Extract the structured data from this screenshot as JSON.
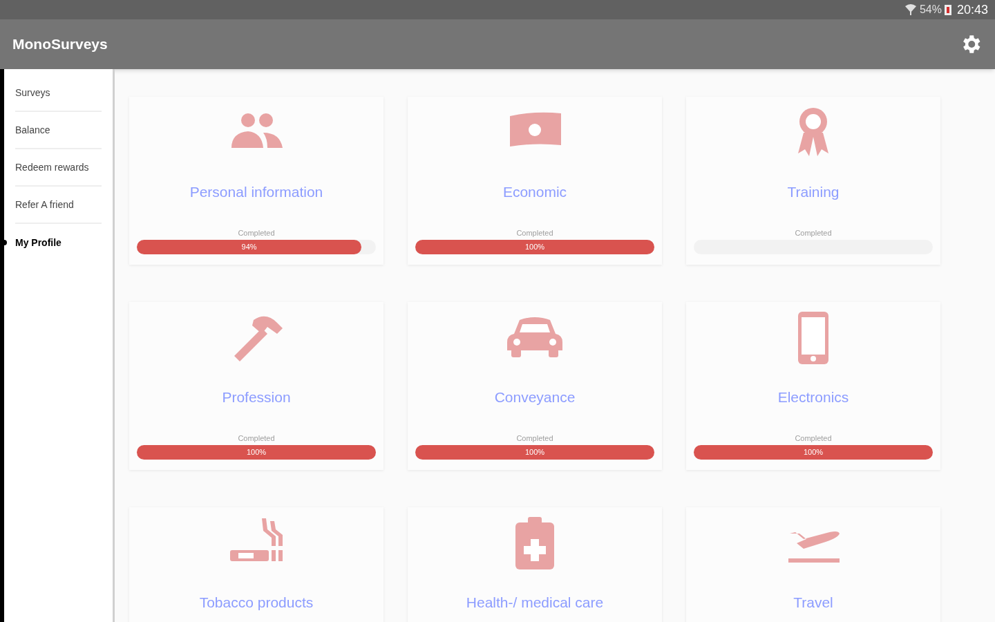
{
  "status_bar": {
    "battery": "54%",
    "time": "20:43"
  },
  "app_bar": {
    "title": "MonoSurveys"
  },
  "sidebar": {
    "items": [
      {
        "label": "Surveys",
        "selected": false
      },
      {
        "label": "Balance",
        "selected": false
      },
      {
        "label": "Redeem rewards",
        "selected": false
      },
      {
        "label": "Refer A friend",
        "selected": false
      },
      {
        "label": "My Profile",
        "selected": true
      }
    ]
  },
  "surveys": [
    {
      "title": "Personal information",
      "progress_label": "Completed",
      "level": 0.94,
      "reading": "94%"
    },
    {
      "title": "Economic",
      "progress_label": "Completed",
      "level": 1,
      "reading": "100%"
    },
    {
      "title": "Training",
      "progress_label": "Completed",
      "level": 0
    },
    {
      "title": "Profession",
      "progress_label": "Completed",
      "level": 1,
      "reading": "100%"
    },
    {
      "title": "Conveyance",
      "progress_label": "Completed",
      "level": 1,
      "reading": "100%"
    },
    {
      "title": "Electronics",
      "progress_label": "Completed",
      "level": 1,
      "reading": "100%"
    },
    {
      "title": "Tobacco products"
    },
    {
      "title": "Health-/ medical care"
    },
    {
      "title": "Travel"
    }
  ]
}
